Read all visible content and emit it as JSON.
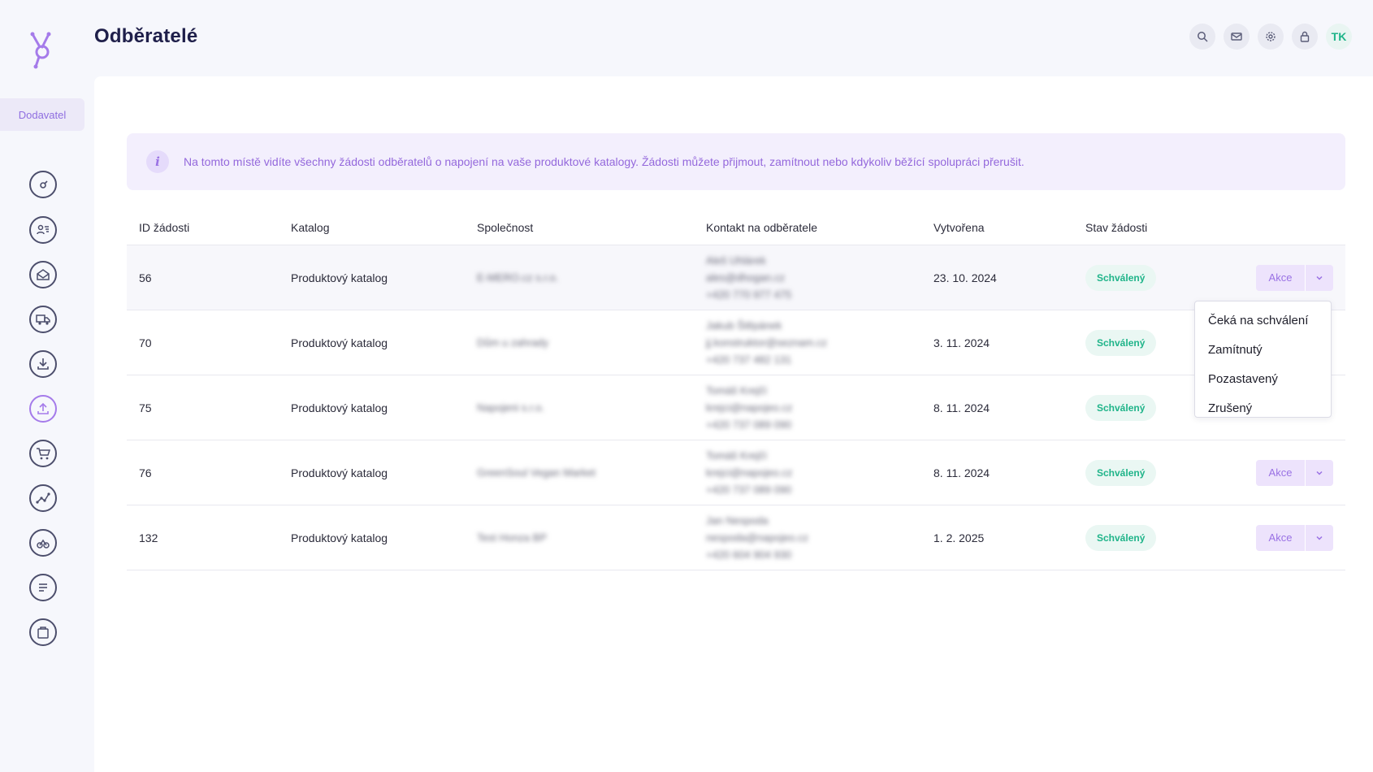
{
  "app": {
    "title": "Odběratelé",
    "role_tab": "Dodavatel"
  },
  "top_bar": {
    "icons": [
      "search-icon",
      "mail-icon",
      "gear-icon",
      "lock-icon"
    ],
    "avatar_initials": "TK"
  },
  "sidebar": {
    "icons": [
      "dashboard-icon",
      "contacts-icon",
      "inbox-icon",
      "truck-icon",
      "download-icon",
      "upload-icon",
      "cart-icon",
      "analytics-icon",
      "speed-icon",
      "list-icon",
      "bag-icon"
    ],
    "active": "upload-icon"
  },
  "info": {
    "text": "Na tomto místě vidíte všechny žádosti odběratelů o napojení na vaše produktové katalogy. Žádosti můžete přijmout, zamítnout nebo kdykoliv běžící spolupráci přerušit."
  },
  "table": {
    "headers": [
      "ID žádosti",
      "Katalog",
      "Společnost",
      "Kontakt na odběratele",
      "Vytvořena",
      "Stav žádosti"
    ],
    "rows": [
      {
        "id": "56",
        "catalog": "Produktový katalog",
        "company": "E-MERO.cz s.r.o.",
        "contact_name": "Aleš Uhlárek",
        "contact_email": "ales@dhogan.cz",
        "contact_phone": "+420 770 977 475",
        "created": "23. 10. 2024",
        "status": "Schválený",
        "action": "Akce"
      },
      {
        "id": "70",
        "catalog": "Produktový katalog",
        "company": "Dům u zahrady",
        "contact_name": "Jakub Štěpánek",
        "contact_email": "jj.konstruktor@seznam.cz",
        "contact_phone": "+420 737 482 131",
        "created": "3. 11. 2024",
        "status": "Schválený",
        "action": "Akce"
      },
      {
        "id": "75",
        "catalog": "Produktový katalog",
        "company": "Napojeni s.r.o.",
        "contact_name": "Tomáš Krejčí",
        "contact_email": "krejci@napojeo.cz",
        "contact_phone": "+420 737 089 090",
        "created": "8. 11. 2024",
        "status": "Schválený",
        "action": "Akce"
      },
      {
        "id": "76",
        "catalog": "Produktový katalog",
        "company": "GreenSoul Vegan Market",
        "contact_name": "Tomáš Krejčí",
        "contact_email": "krejci@napojeo.cz",
        "contact_phone": "+420 737 089 090",
        "created": "8. 11. 2024",
        "status": "Schválený",
        "action": "Akce"
      },
      {
        "id": "132",
        "catalog": "Produktový katalog",
        "company": "Test Honza BP",
        "contact_name": "Jan Nespoda",
        "contact_email": "nespoda@napojeo.cz",
        "contact_phone": "+420 604 904 930",
        "created": "1. 2. 2025",
        "status": "Schválený",
        "action": "Akce"
      }
    ]
  },
  "dropdown": {
    "items": [
      "Čeká na schválení",
      "Zamítnutý",
      "Pozastavený",
      "Zrušený"
    ]
  },
  "colors": {
    "accent": "#a57bea",
    "success": "#1fb489",
    "title": "#1f1f4a"
  }
}
